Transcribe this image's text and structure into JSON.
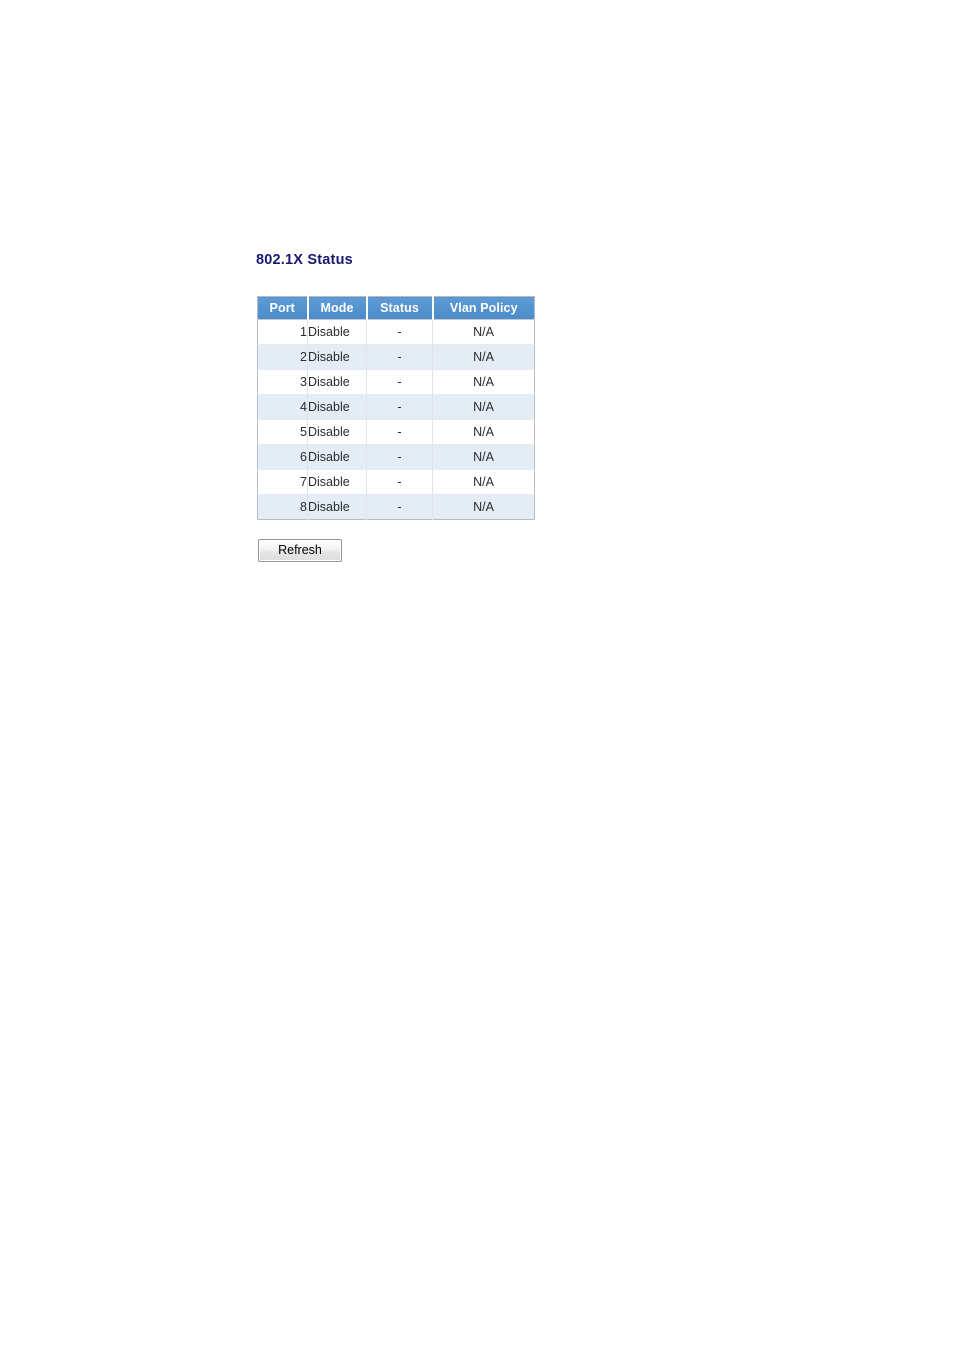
{
  "page": {
    "title": "802.1X Status",
    "background_color": "#ffffff",
    "title_color": "#191970"
  },
  "table": {
    "name": "802.1X Status",
    "header_background": "#4e8fcc",
    "header_text_color": "#ffffff",
    "alt_row_background": "#e4ecf6",
    "columns": [
      {
        "key": "port",
        "label": "Port"
      },
      {
        "key": "mode",
        "label": "Mode"
      },
      {
        "key": "status",
        "label": "Status"
      },
      {
        "key": "vlan_policy",
        "label": "Vlan Policy"
      }
    ],
    "rows": [
      {
        "port": "1",
        "mode": "Disable",
        "status": "-",
        "vlan_policy": "N/A"
      },
      {
        "port": "2",
        "mode": "Disable",
        "status": "-",
        "vlan_policy": "N/A"
      },
      {
        "port": "3",
        "mode": "Disable",
        "status": "-",
        "vlan_policy": "N/A"
      },
      {
        "port": "4",
        "mode": "Disable",
        "status": "-",
        "vlan_policy": "N/A"
      },
      {
        "port": "5",
        "mode": "Disable",
        "status": "-",
        "vlan_policy": "N/A"
      },
      {
        "port": "6",
        "mode": "Disable",
        "status": "-",
        "vlan_policy": "N/A"
      },
      {
        "port": "7",
        "mode": "Disable",
        "status": "-",
        "vlan_policy": "N/A"
      },
      {
        "port": "8",
        "mode": "Disable",
        "status": "-",
        "vlan_policy": "N/A"
      }
    ]
  },
  "actions": {
    "refresh_label": "Refresh"
  }
}
